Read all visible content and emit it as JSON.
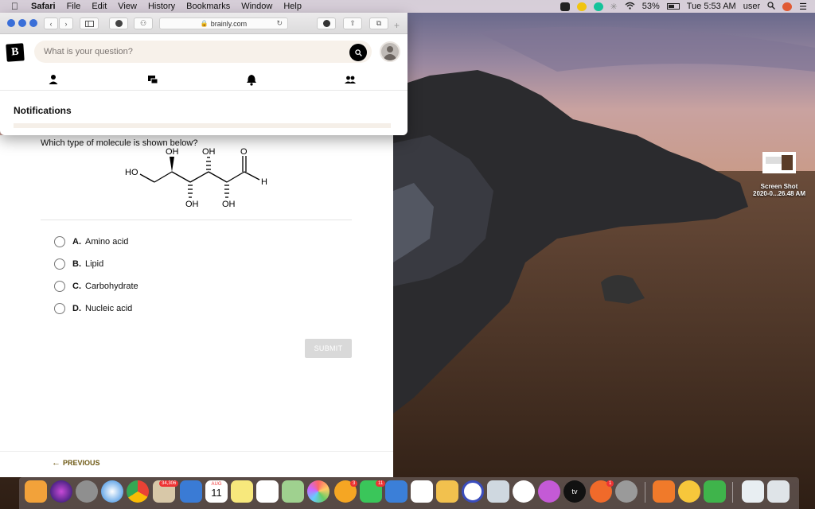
{
  "menubar": {
    "app_name": "Safari",
    "items": [
      "File",
      "Edit",
      "View",
      "History",
      "Bookmarks",
      "Window",
      "Help"
    ],
    "battery": "53%",
    "clock": "Tue 5:53 AM",
    "user": "user"
  },
  "browser": {
    "url": "brainly.com",
    "logo_text": "B",
    "search_placeholder": "What is your question?"
  },
  "notifications": {
    "title": "Notifications"
  },
  "question": {
    "text": "Which type of molecule is shown below?",
    "molecule_labels": [
      "OH",
      "OH",
      "O",
      "HO",
      "H",
      "OH",
      "OH"
    ],
    "options": [
      {
        "letter": "A.",
        "label": "Amino acid"
      },
      {
        "letter": "B.",
        "label": "Lipid"
      },
      {
        "letter": "C.",
        "label": "Carbohydrate"
      },
      {
        "letter": "D.",
        "label": "Nucleic acid"
      }
    ],
    "submit_label": "SUBMIT",
    "previous_label": "PREVIOUS"
  },
  "desktop": {
    "file_line1": "Screen Shot",
    "file_line2": "2020-0...26.48 AM"
  },
  "dock": {
    "badges": [
      "34,306",
      "3",
      "11",
      "1"
    ],
    "calendar_month": "AUG",
    "calendar_day": "11",
    "tv_label": "tv"
  }
}
